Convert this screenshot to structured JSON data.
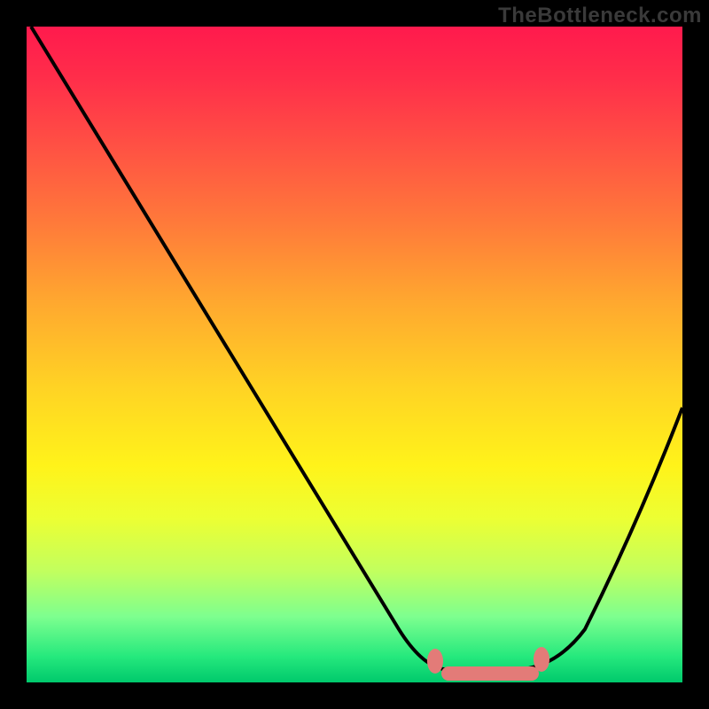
{
  "watermark": "TheBottleneck.com",
  "chart_data": {
    "type": "line",
    "title": "",
    "xlabel": "",
    "ylabel": "",
    "xlim": [
      0,
      100
    ],
    "ylim": [
      0,
      100
    ],
    "background": "red-yellow-green vertical gradient",
    "series": [
      {
        "name": "bottleneck-curve",
        "x": [
          0,
          10,
          20,
          30,
          40,
          50,
          58,
          62,
          70,
          78,
          85,
          92,
          100
        ],
        "y": [
          100,
          86,
          72,
          58,
          44,
          30,
          14,
          6,
          2,
          2,
          8,
          22,
          42
        ]
      }
    ],
    "optimal_range": {
      "x_start": 62,
      "x_end": 78,
      "y": 2
    },
    "gradient_stops": [
      {
        "pos": 0.0,
        "color": "#ff1a4d"
      },
      {
        "pos": 0.55,
        "color": "#ffd324"
      },
      {
        "pos": 0.75,
        "color": "#ecff33"
      },
      {
        "pos": 1.0,
        "color": "#00c96c"
      }
    ]
  }
}
